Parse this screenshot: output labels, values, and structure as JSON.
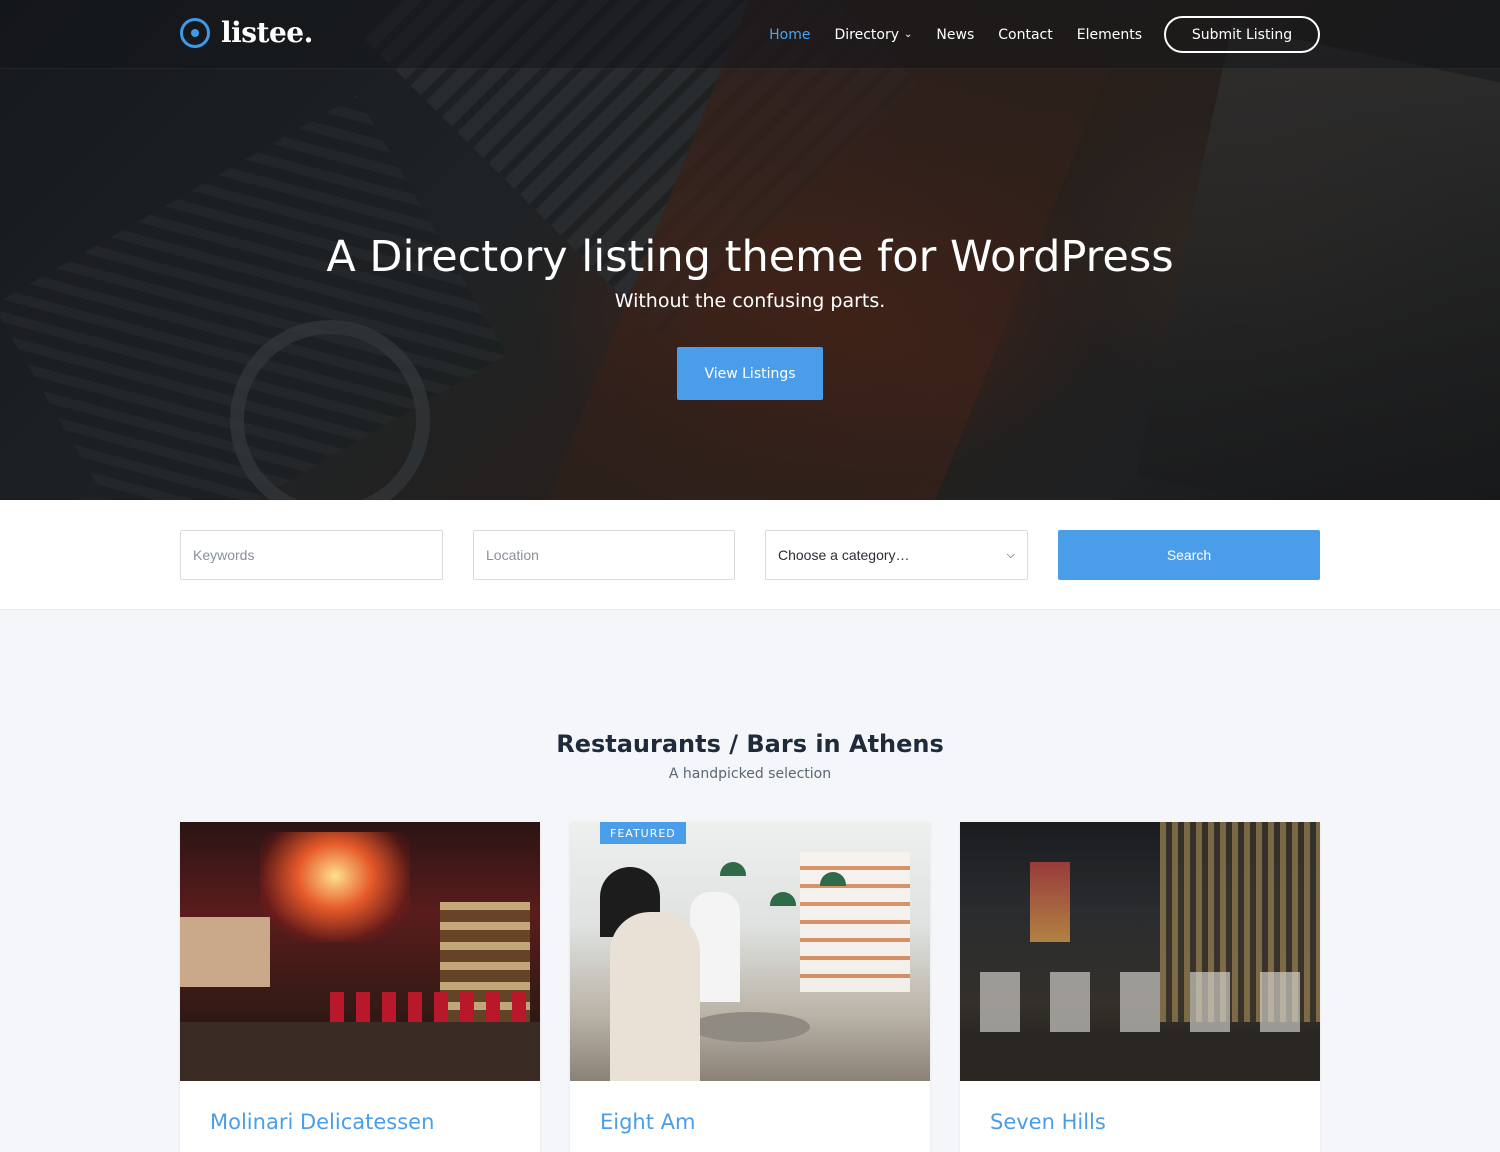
{
  "brand": {
    "name": "listee."
  },
  "nav": {
    "items": [
      {
        "label": "Home",
        "active": true
      },
      {
        "label": "Directory",
        "has_dropdown": true
      },
      {
        "label": "News"
      },
      {
        "label": "Contact"
      },
      {
        "label": "Elements"
      }
    ],
    "submit_label": "Submit Listing"
  },
  "hero": {
    "title": "A Directory listing theme for WordPress",
    "subtitle": "Without the confusing parts.",
    "button": "View Listings"
  },
  "search": {
    "keywords_placeholder": "Keywords",
    "location_placeholder": "Location",
    "category_selected": "Choose a category…",
    "button": "Search"
  },
  "section": {
    "title": "Restaurants / Bars in Athens",
    "subtitle": "A handpicked selection"
  },
  "listings": [
    {
      "name": "Molinari Delicatessen",
      "featured": false
    },
    {
      "name": "Eight Am",
      "featured": true,
      "badge": "FEATURED"
    },
    {
      "name": "Seven Hills",
      "featured": false
    }
  ],
  "colors": {
    "accent": "#4a9ee9",
    "nav_active": "#4aa3f0",
    "heading": "#1f2b3a"
  },
  "icons": {
    "logo": "target-dot-icon",
    "dropdown": "chevron-down-icon",
    "select_caret": "chevron-down-icon"
  }
}
